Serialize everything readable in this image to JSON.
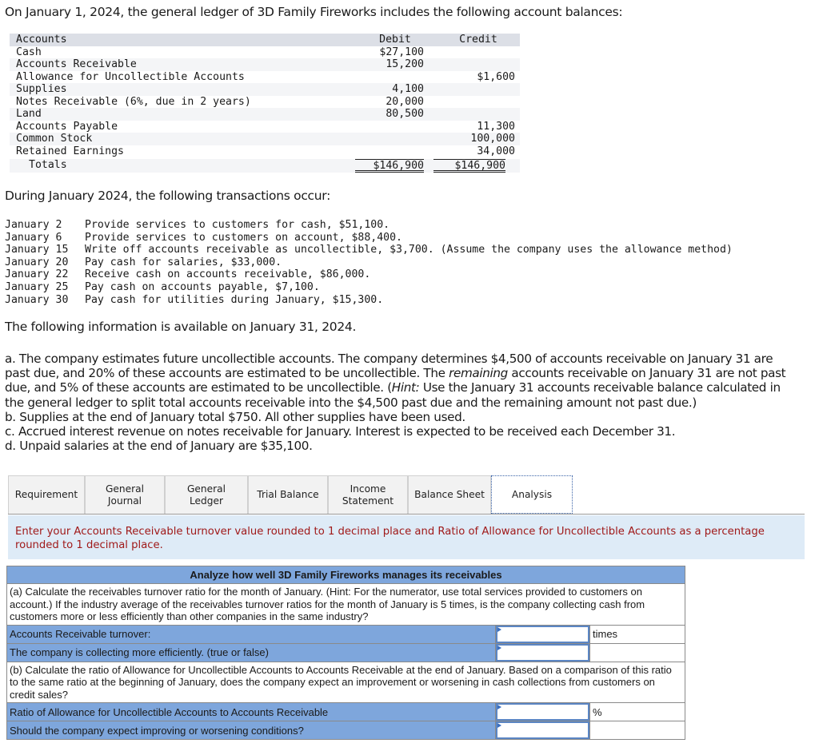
{
  "intro": "On January 1, 2024, the general ledger of 3D Family Fireworks includes the following account balances:",
  "ledger": {
    "headers": {
      "account": "Accounts",
      "debit": "Debit",
      "credit": "Credit"
    },
    "rows": [
      {
        "account": "Cash",
        "debit": "$27,100",
        "credit": ""
      },
      {
        "account": "Accounts Receivable",
        "debit": "15,200",
        "credit": ""
      },
      {
        "account": "Allowance for Uncollectible Accounts",
        "debit": "",
        "credit": "$1,600"
      },
      {
        "account": "Supplies",
        "debit": "4,100",
        "credit": ""
      },
      {
        "account": "Notes Receivable (6%, due in 2 years)",
        "debit": "20,000",
        "credit": ""
      },
      {
        "account": "Land",
        "debit": "80,500",
        "credit": ""
      },
      {
        "account": "Accounts Payable",
        "debit": "",
        "credit": "11,300"
      },
      {
        "account": "Common Stock",
        "debit": "",
        "credit": "100,000"
      },
      {
        "account": "Retained Earnings",
        "debit": "",
        "credit": "34,000"
      }
    ],
    "totals": {
      "label": "Totals",
      "debit": "$146,900",
      "credit": "$146,900"
    }
  },
  "transactions_intro": "During January 2024, the following transactions occur:",
  "transactions": [
    {
      "date": "January 2",
      "text": "Provide services to customers for cash, $51,100."
    },
    {
      "date": "January 6",
      "text": "Provide services to customers on account, $88,400."
    },
    {
      "date": "January 15",
      "text": "Write off accounts receivable as uncollectible, $3,700. (Assume the company uses the allowance method)"
    },
    {
      "date": "January 20",
      "text": "Pay cash for salaries, $33,000."
    },
    {
      "date": "January 22",
      "text": "Receive cash on accounts receivable, $86,000."
    },
    {
      "date": "January 25",
      "text": "Pay cash on accounts payable, $7,100."
    },
    {
      "date": "January 30",
      "text": "Pay cash for utilities during January, $15,300."
    }
  ],
  "info_intro": "The following information is available on January 31, 2024.",
  "notes": {
    "a_part1": "a. The company estimates future uncollectible accounts. The company determines $4,500 of accounts receivable on January 31 are past due, and 20% of these accounts are estimated to be uncollectible. The ",
    "a_italic": "remaining",
    "a_part2": " accounts receivable on January 31 are not past due, and 5% of these accounts are estimated to be uncollectible. (",
    "a_hint": "Hint:",
    "a_part3": " Use the January 31 accounts receivable balance calculated in the general ledger to split total accounts receivable into the $4,500 past due and the remaining amount not past due.)",
    "b": "b. Supplies at the end of January total $750. All other supplies have been used.",
    "c": "c. Accrued interest revenue on notes receivable for January. Interest is expected to be received each December 31.",
    "d": "d. Unpaid salaries at the end of January are $35,100."
  },
  "tabs": [
    {
      "label": "Requirement",
      "active": false
    },
    {
      "label": "General Journal",
      "active": false
    },
    {
      "label": "General Ledger",
      "active": false
    },
    {
      "label": "Trial Balance",
      "active": false
    },
    {
      "label": "Income Statement",
      "active": false
    },
    {
      "label": "Balance Sheet",
      "active": false
    },
    {
      "label": "Analysis",
      "active": true
    }
  ],
  "instruction": "Enter your Accounts Receivable turnover value rounded to 1 decimal place and Ratio of Allowance for Uncollectible Accounts as a percentage rounded to 1 decimal place.",
  "analysis": {
    "title": "Analyze how well 3D Family Fireworks manages its receivables",
    "question_a": "(a) Calculate the receivables turnover ratio for the month of January. (Hint: For the numerator, use total services provided to customers on account.) If the industry average of the receivables turnover ratios for the month of January is 5 times, is the company collecting cash from customers more or less efficiently than other companies in the same industry?",
    "ar_turnover_label": "Accounts Receivable turnover:",
    "ar_turnover_value": "",
    "ar_turnover_unit": "times",
    "efficiency_label": "The company is collecting more efficiently. (true or false)",
    "efficiency_value": "",
    "efficiency_unit": "",
    "question_b": "(b) Calculate the ratio of Allowance for Uncollectible Accounts to Accounts Receivable at the end of January. Based on a comparison of this ratio to the same ratio at the beginning of January, does the company expect an improvement or worsening in cash collections from customers on credit sales?",
    "ratio_label": "Ratio of Allowance for Uncollectible Accounts to Accounts Receivable",
    "ratio_value": "",
    "ratio_unit": "%",
    "conditions_label": "Should the company expect improving or worsening conditions?",
    "conditions_value": "",
    "conditions_unit": ""
  }
}
